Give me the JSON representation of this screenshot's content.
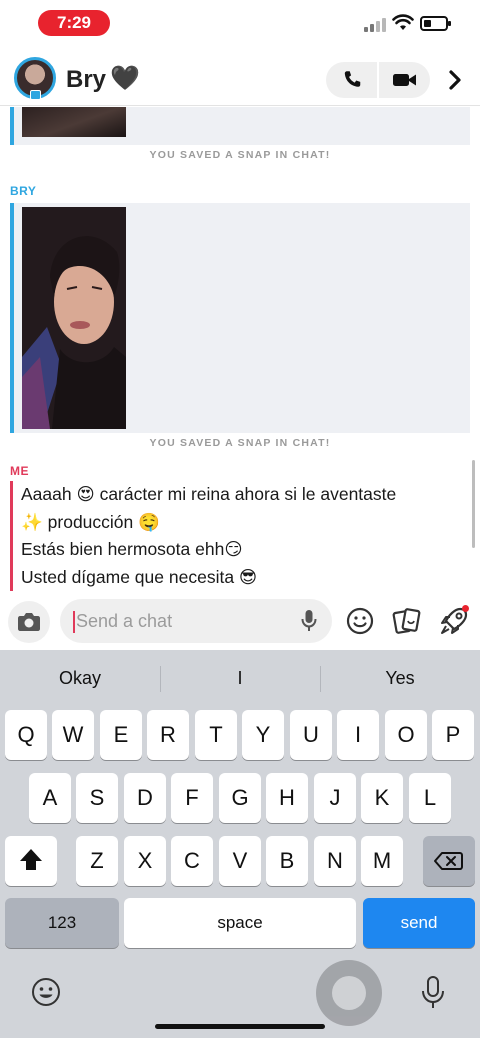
{
  "status_bar": {
    "time": "7:29"
  },
  "header": {
    "contact_name": "Bry",
    "heart": "🖤"
  },
  "chat": {
    "saved_note_1": "YOU SAVED A SNAP IN CHAT!",
    "sender_1": "BRY",
    "saved_note_2": "YOU SAVED A SNAP IN CHAT!",
    "sender_2": "ME",
    "messages": [
      "Aaaah 😍 carácter mi reina ahora si le aventaste",
      "✨ producción 🤤",
      "Estás bien hermosota ehh😏",
      "Usted dígame que necesita 😎"
    ]
  },
  "input": {
    "placeholder": "Send a chat"
  },
  "keyboard": {
    "suggestions": [
      "Okay",
      "I",
      "Yes"
    ],
    "row1": [
      "Q",
      "W",
      "E",
      "R",
      "T",
      "Y",
      "U",
      "I",
      "O",
      "P"
    ],
    "row2": [
      "A",
      "S",
      "D",
      "F",
      "G",
      "H",
      "J",
      "K",
      "L"
    ],
    "row3": [
      "Z",
      "X",
      "C",
      "V",
      "B",
      "N",
      "M"
    ],
    "numbers_key": "123",
    "space_key": "space",
    "send_key": "send"
  },
  "colors": {
    "accent_blue": "#2fa6e0",
    "me_pink": "#e03a5a",
    "send_blue": "#1e87f0",
    "time_pill": "#e8232e"
  }
}
